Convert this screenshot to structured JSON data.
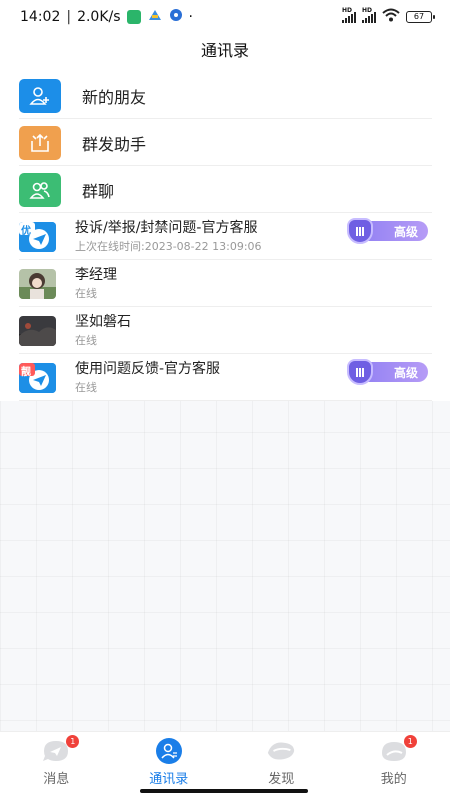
{
  "status": {
    "time": "14:02",
    "separator": "|",
    "speed": "2.0K/s",
    "dot": "·",
    "hd1": "HD",
    "hd2": "HD",
    "battery": "67"
  },
  "header": {
    "title": "通讯录"
  },
  "menu": [
    {
      "label": "新的朋友",
      "icon": "add-user-icon",
      "color": "#1c8ee8"
    },
    {
      "label": "群发助手",
      "icon": "broadcast-icon",
      "color": "#f0a04e"
    },
    {
      "label": "群聊",
      "icon": "group-icon",
      "color": "#3cbd74"
    }
  ],
  "contacts": [
    {
      "name": "投诉/举报/封禁问题-官方客服",
      "sub": "上次在线时间:2023-08-22 13:09:06",
      "badge": "高级",
      "avatar_tag": "优"
    },
    {
      "name": "李经理",
      "sub": "在线"
    },
    {
      "name": "坚如磐石",
      "sub": "在线"
    },
    {
      "name": "使用问题反馈-官方客服",
      "sub": "在线",
      "badge": "高级",
      "avatar_tag": "靓"
    }
  ],
  "tabs": [
    {
      "label": "消息",
      "badge": "1",
      "icon": "chat-icon",
      "active": false
    },
    {
      "label": "通讯录",
      "icon": "contacts-icon",
      "active": true
    },
    {
      "label": "发现",
      "icon": "discover-icon",
      "active": false
    },
    {
      "label": "我的",
      "badge": "1",
      "icon": "profile-icon",
      "active": false
    }
  ],
  "colors": {
    "accent": "#1a7ee8",
    "vip": "#8c7cf2",
    "badge": "#f0413a"
  }
}
